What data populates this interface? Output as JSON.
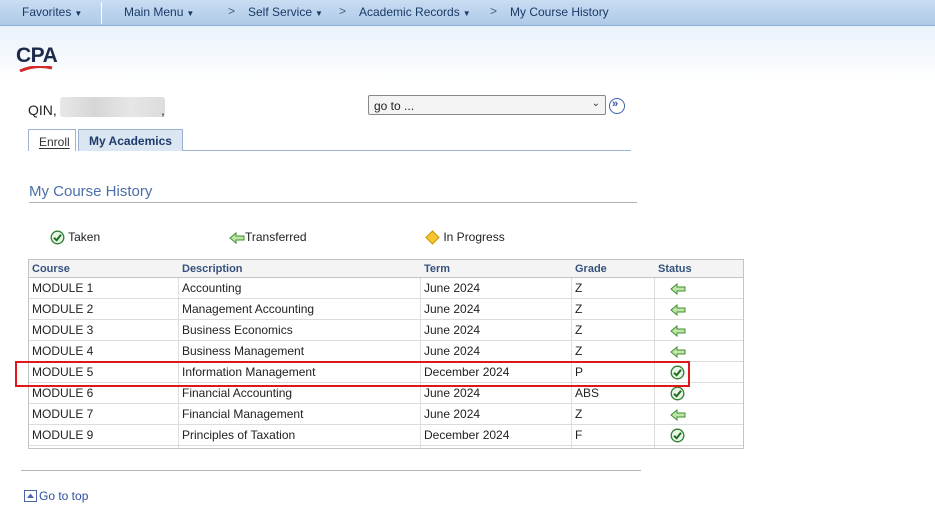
{
  "nav": {
    "favorites": "Favorites",
    "main_menu": "Main Menu",
    "self_service": "Self Service",
    "academic_records": "Academic Records",
    "current_page": "My Course History"
  },
  "header": {
    "logo_text": "CPA"
  },
  "student": {
    "name_prefix": "QIN,",
    "name_suffix": ","
  },
  "goto": {
    "value": "go to ..."
  },
  "tabs": [
    {
      "label": "Enroll"
    },
    {
      "label": "My Academics"
    }
  ],
  "section": {
    "title": "My Course History"
  },
  "legend": {
    "taken": "Taken",
    "transferred": "Transferred",
    "in_progress": "In Progress"
  },
  "table": {
    "headers": [
      "Course",
      "Description",
      "Term",
      "Grade",
      "Status"
    ],
    "rows": [
      {
        "course": "MODULE 1",
        "description": "Accounting",
        "term": "June 2024",
        "grade": "Z",
        "status": "transferred"
      },
      {
        "course": "MODULE 2",
        "description": "Management Accounting",
        "term": "June 2024",
        "grade": "Z",
        "status": "transferred"
      },
      {
        "course": "MODULE 3",
        "description": "Business Economics",
        "term": "June 2024",
        "grade": "Z",
        "status": "transferred"
      },
      {
        "course": "MODULE 4",
        "description": "Business Management",
        "term": "June 2024",
        "grade": "Z",
        "status": "transferred"
      },
      {
        "course": "MODULE 5",
        "description": "Information Management",
        "term": "December 2024",
        "grade": "P",
        "status": "taken"
      },
      {
        "course": "MODULE 6",
        "description": "Financial Accounting",
        "term": "June 2024",
        "grade": "ABS",
        "status": "taken"
      },
      {
        "course": "MODULE 7",
        "description": "Financial Management",
        "term": "June 2024",
        "grade": "Z",
        "status": "transferred"
      },
      {
        "course": "MODULE 9",
        "description": "Principles of Taxation",
        "term": "December 2024",
        "grade": "F",
        "status": "taken"
      }
    ]
  },
  "footer": {
    "go_to_top": "Go to top"
  },
  "colors": {
    "nav_bar": "#aecae8",
    "link_blue": "#2d4f9e",
    "section_title": "#4a6ea8",
    "highlight": "#e0161d",
    "taken_green": "#2e8b2e",
    "transferred_green": "#5cb85c",
    "in_progress_gold": "#f0b400"
  },
  "icons": {
    "taken": "check-circle-icon",
    "transferred": "left-arrow-icon",
    "in_progress": "diamond-icon"
  }
}
